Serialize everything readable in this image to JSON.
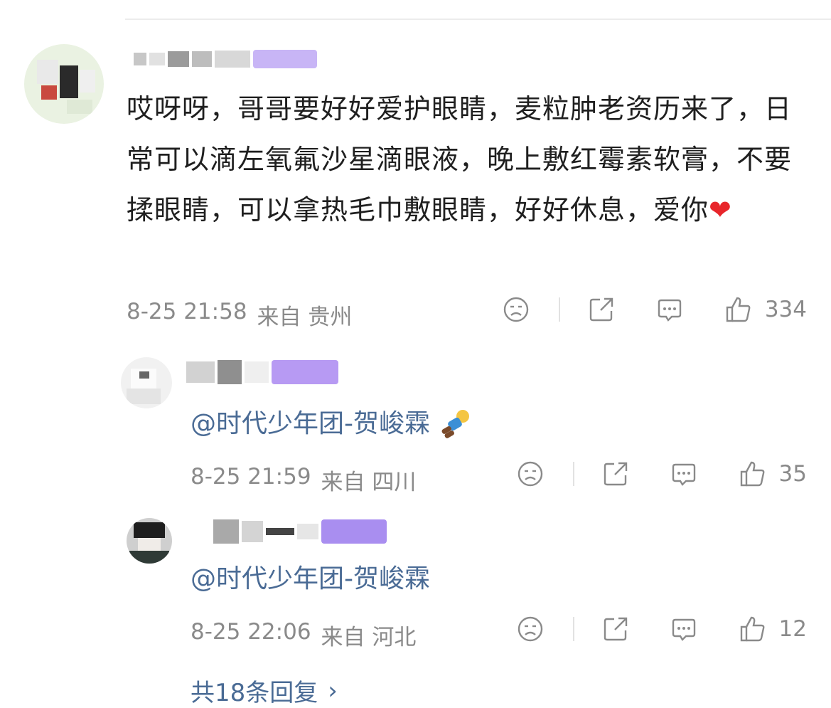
{
  "main_comment": {
    "text": "哎呀呀，哥哥要好好爱护眼睛，麦粒肿老资历来了，日常可以滴左氧氟沙星滴眼液，晚上敷红霉素软膏，不要揉眼睛，可以拿热毛巾敷眼睛，好好休息，爱你",
    "heart": "❤",
    "date": "8-25 21:58",
    "source": "来自 贵州",
    "likes": "334"
  },
  "replies": [
    {
      "mention": "@时代少年团-贺峻霖",
      "date": "8-25 21:59",
      "source": "来自 四川",
      "likes": "35"
    },
    {
      "mention": "@时代少年团-贺峻霖",
      "date": "8-25 22:06",
      "source": "来自 河北",
      "likes": "12"
    }
  ],
  "more_replies": {
    "label": "共18条回复",
    "chevron": "›"
  },
  "colors": {
    "link": "#4a6b95",
    "meta": "#8a8a8a",
    "heart": "#e8262b",
    "badge": "#a57cf0"
  }
}
